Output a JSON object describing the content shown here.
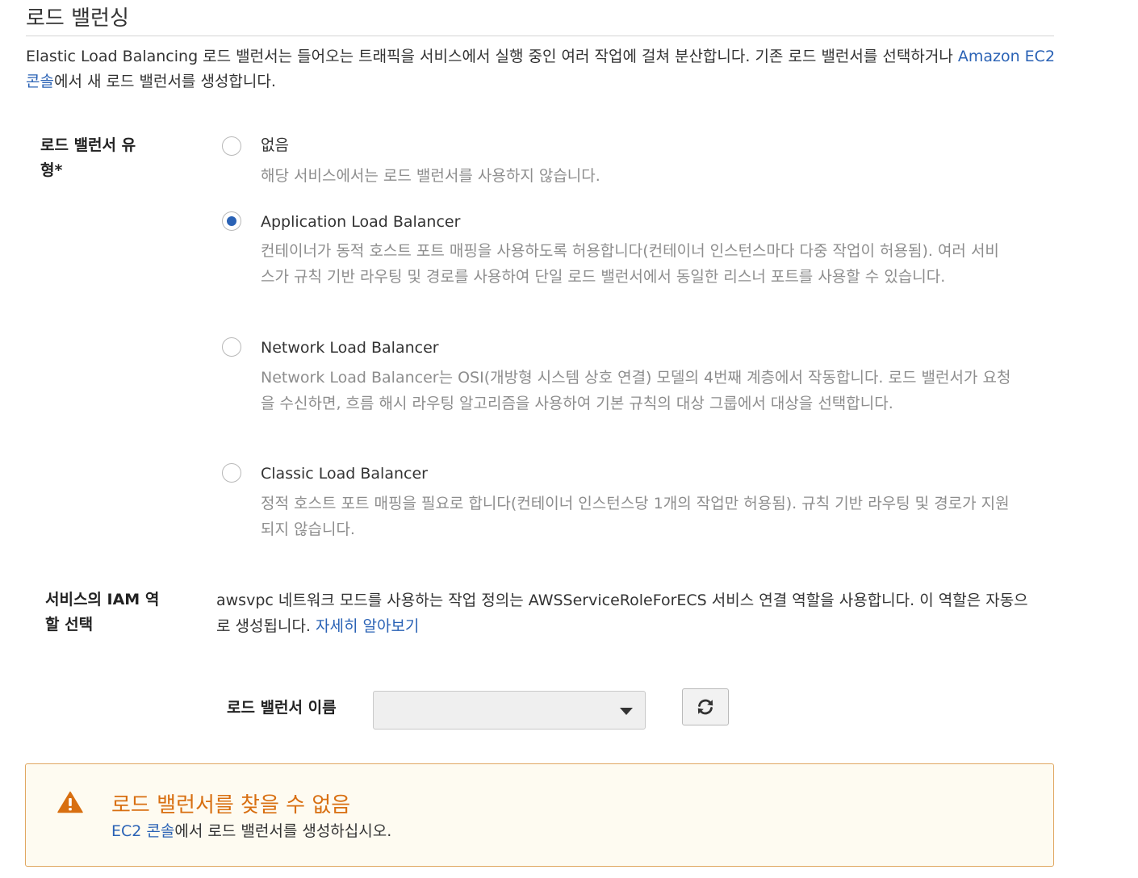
{
  "section": {
    "title": "로드 밸런싱",
    "intro_part1": "Elastic Load Balancing 로드 밸런서는 들어오는 트래픽을 서비스에서 실행 중인 여러 작업에 걸쳐 분산합니다. 기존 로드 밸런서를 선택하거나 ",
    "intro_link": "Amazon EC2 콘솔",
    "intro_part2": "에서 새 로드 밸런서를 생성합니다."
  },
  "lb_type": {
    "label_line1": "로드 밸런서 유",
    "label_line2": "형*",
    "selected": "application",
    "options": [
      {
        "title": "없음",
        "desc": "해당 서비스에서는 로드 밸런서를 사용하지 않습니다."
      },
      {
        "title": "Application Load Balancer",
        "desc": "컨테이너가 동적 호스트 포트 매핑을 사용하도록 허용합니다(컨테이너 인스턴스마다 다중 작업이 허용됨). 여러 서비스가 규칙 기반 라우팅 및 경로를 사용하여 단일 로드 밸런서에서 동일한 리스너 포트를 사용할 수 있습니다."
      },
      {
        "title": "Network Load Balancer",
        "desc": "Network Load Balancer는 OSI(개방형 시스템 상호 연결) 모델의 4번째 계층에서 작동합니다. 로드 밸런서가 요청을 수신하면, 흐름 해시 라우팅 알고리즘을 사용하여 기본 규칙의 대상 그룹에서 대상을 선택합니다."
      },
      {
        "title": "Classic Load Balancer",
        "desc": "정적 호스트 포트 매핑을 필요로 합니다(컨테이너 인스턴스당 1개의 작업만 허용됨). 규칙 기반 라우팅 및 경로가 지원되지 않습니다."
      }
    ]
  },
  "iam": {
    "label_line1": "서비스의 IAM 역",
    "label_line2": "할 선택",
    "text": "awsvpc 네트워크 모드를 사용하는 작업 정의는 AWSServiceRoleForECS 서비스 연결 역할을 사용합니다. 이 역할은 자동으로 생성됩니다. ",
    "link": "자세히 알아보기"
  },
  "lb_name": {
    "label": "로드 밸런서 이름",
    "selected_value": ""
  },
  "alert": {
    "title": "로드 밸런서를 찾을 수 없음",
    "link": "EC2 콘솔",
    "body": "에서 로드 밸런서를 생성하십시오."
  },
  "colors": {
    "link": "#2a62b5",
    "radio_selected": "#2a62b5",
    "alert_title": "#d86f11",
    "alert_border": "#e0a760",
    "alert_bg": "#fefbf1"
  },
  "icons": {
    "refresh": "refresh-icon",
    "warning": "warning-icon"
  }
}
